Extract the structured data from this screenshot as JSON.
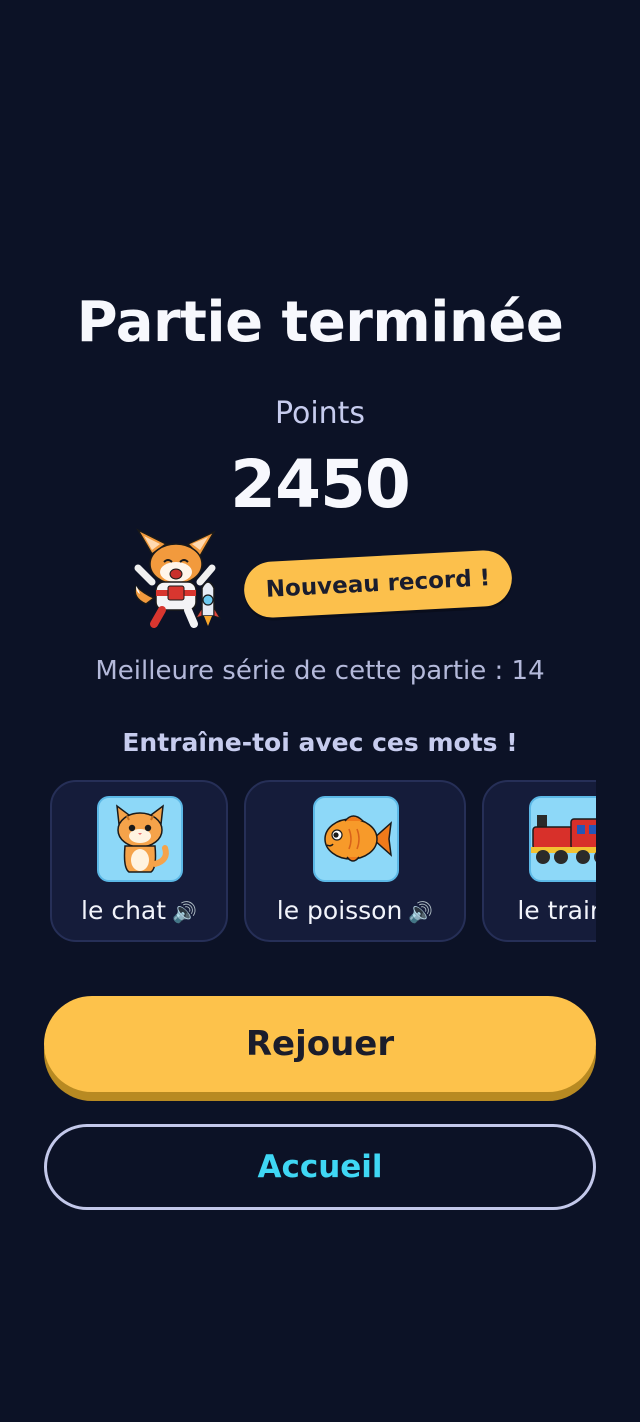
{
  "result": {
    "title": "Partie terminée",
    "points_label": "Points",
    "score": "2450",
    "record_badge": "Nouveau record !",
    "best_streak": "Meilleure série de cette partie : 14"
  },
  "practice": {
    "title": "Entraîne-toi avec ces mots !",
    "words": [
      {
        "label": "le chat",
        "icon": "cat-icon"
      },
      {
        "label": "le poisson",
        "icon": "fish-icon"
      },
      {
        "label": "le train",
        "icon": "train-icon"
      }
    ]
  },
  "actions": {
    "replay_label": "Rejouer",
    "home_label": "Accueil"
  },
  "colors": {
    "background": "#0c1226",
    "accent_yellow": "#fdc24b",
    "accent_cyan": "#3fd7f4"
  }
}
